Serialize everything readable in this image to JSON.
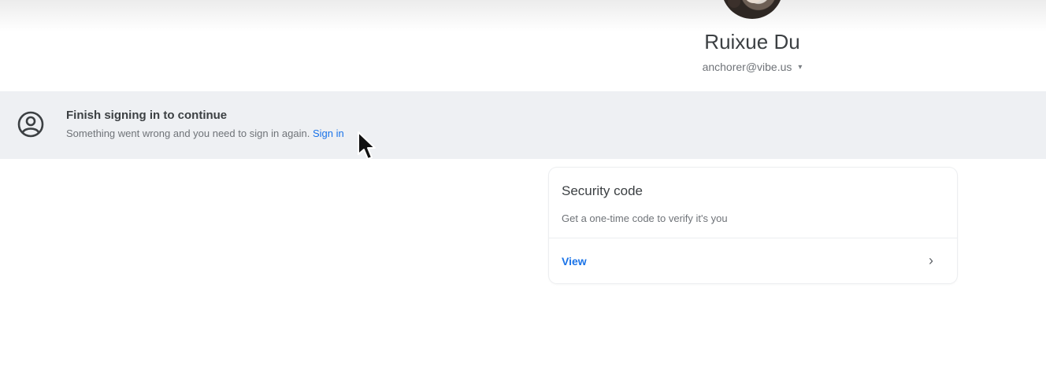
{
  "profile": {
    "name": "Ruixue Du",
    "email": "anchorer@vibe.us",
    "chevron": "▾"
  },
  "banner": {
    "icon": "account-circle-icon",
    "title": "Finish signing in to continue",
    "message": "Something went wrong and you need to sign in again.",
    "link_label": "Sign in"
  },
  "security_card": {
    "title": "Security code",
    "description": "Get a one-time code to verify it's you",
    "action_label": "View",
    "action_icon": "chevron-right-icon"
  },
  "colors": {
    "accent": "#1a73e8",
    "banner_bg": "#eef0f3"
  }
}
